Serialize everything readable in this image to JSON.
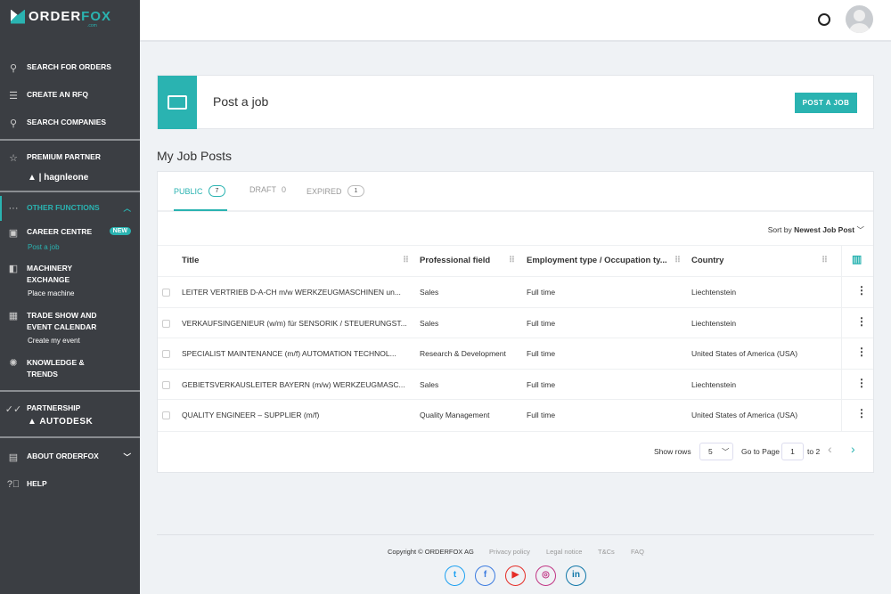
{
  "brand": {
    "name_a": "ORDER",
    "name_b": "FOX",
    "suffix": ".com"
  },
  "sidebar": {
    "items": [
      {
        "label": "SEARCH FOR ORDERS",
        "icon": "search-icon"
      },
      {
        "label": "CREATE AN RFQ",
        "icon": "document-icon"
      },
      {
        "label": "SEARCH COMPANIES",
        "icon": "search-icon"
      }
    ],
    "premium": {
      "label": "PREMIUM PARTNER",
      "partner": "hagnleone"
    },
    "other": {
      "label": "OTHER FUNCTIONS"
    },
    "career": {
      "label": "CAREER CENTRE",
      "badge": "NEW",
      "sub": "Post a job"
    },
    "machinery": {
      "label1": "MACHINERY",
      "label2": "EXCHANGE",
      "sub": "Place machine"
    },
    "trade": {
      "label1": "TRADE SHOW AND",
      "label2": "EVENT CALENDAR",
      "sub": "Create my event"
    },
    "knowledge": {
      "label1": "KNOWLEDGE &",
      "label2": "TRENDS"
    },
    "partnership": {
      "label": "PARTNERSHIP",
      "partner": "AUTODESK"
    },
    "about": {
      "label": "ABOUT ORDERFOX"
    },
    "help": {
      "label": "HELP"
    }
  },
  "post": {
    "title": "Post a job",
    "button": "POST A JOB"
  },
  "section_title": "My Job Posts",
  "tabs": [
    {
      "label": "PUBLIC",
      "count": "7"
    },
    {
      "label": "DRAFT",
      "count": "0"
    },
    {
      "label": "EXPIRED",
      "count": "1"
    }
  ],
  "sort": {
    "label": "Sort by",
    "value": "Newest Job Post"
  },
  "table": {
    "columns": [
      "Title",
      "Professional field",
      "Employment type / Occupation ty...",
      "Country"
    ],
    "rows": [
      [
        "LEITER VERTRIEB D-A-CH m/w WERKZEUGMASCHINEN un...",
        "Sales",
        "Full time",
        "Liechtenstein"
      ],
      [
        "VERKAUFSINGENIEUR (w/m) für SENSORIK / STEUERUNGST...",
        "Sales",
        "Full time",
        "Liechtenstein"
      ],
      [
        "SPECIALIST MAINTENANCE (m/f) AUTOMATION TECHNOL...",
        "Research & Development",
        "Full time",
        "United States of America (USA)"
      ],
      [
        "GEBIETSVERKAUSLEITER BAYERN (m/w) WERKZEUGMASC...",
        "Sales",
        "Full time",
        "Liechtenstein"
      ],
      [
        "QUALITY ENGINEER – SUPPLIER (m/f)",
        "Quality Management",
        "Full time",
        "United States of America (USA)"
      ]
    ]
  },
  "pagination": {
    "show_rows": "Show rows",
    "rows_value": "5",
    "goto": "Go to Page",
    "page": "1",
    "total": "to 2"
  },
  "footer": {
    "copyright": "Copyright © ORDERFOX AG",
    "links": [
      "Privacy policy",
      "Legal notice",
      "T&Cs",
      "FAQ"
    ],
    "social": [
      {
        "name": "twitter",
        "glyph": "t",
        "color": "#1da1f2"
      },
      {
        "name": "facebook",
        "glyph": "f",
        "color": "#3b7be0"
      },
      {
        "name": "youtube",
        "glyph": "▶",
        "color": "#e52d27"
      },
      {
        "name": "instagram",
        "glyph": "◎",
        "color": "#c13584"
      },
      {
        "name": "linkedin",
        "glyph": "in",
        "color": "#0e76a8"
      }
    ]
  },
  "colors": {
    "accent": "#2ab3b1",
    "sidebar": "#3b3e43"
  }
}
